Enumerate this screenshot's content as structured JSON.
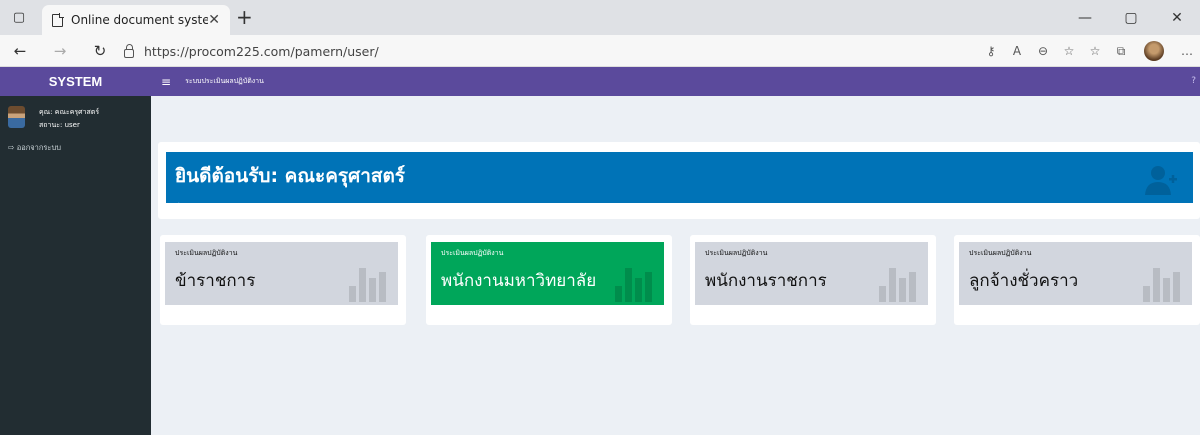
{
  "browser": {
    "tab_title": "Online document system",
    "url": "https://procom225.com/pamern/user/"
  },
  "sidebar": {
    "logo": "SYSTEM",
    "user_name": "คุณ: คณะครุศาสตร์",
    "user_status": "สถานะ: user",
    "logout": "ออกจากระบบ"
  },
  "topbar": {
    "title": "ระบบประเมินผลปฏิบัติงาน"
  },
  "welcome": {
    "title": "ยินดีต้อนรับ: คณะครุศาสตร์",
    "status": "สถานะ user"
  },
  "cards": [
    {
      "label": "ประเมินผลปฏิบัติงาน",
      "title": "ข้าราชการ"
    },
    {
      "label": "ประเมินผลปฏิบัติงาน",
      "title": "พนักงานมหาวิทยาลัย"
    },
    {
      "label": "ประเมินผลปฏิบัติงาน",
      "title": "พนักงานราชการ"
    },
    {
      "label": "ประเมินผลปฏิบัติงาน",
      "title": "ลูกจ้างชั่วคราว"
    }
  ],
  "colors": {
    "header": "#5b4a9c",
    "sidebar": "#222d32",
    "welcome_box": "#0073b7",
    "active_card": "#00a65a",
    "card": "#d2d6de"
  }
}
